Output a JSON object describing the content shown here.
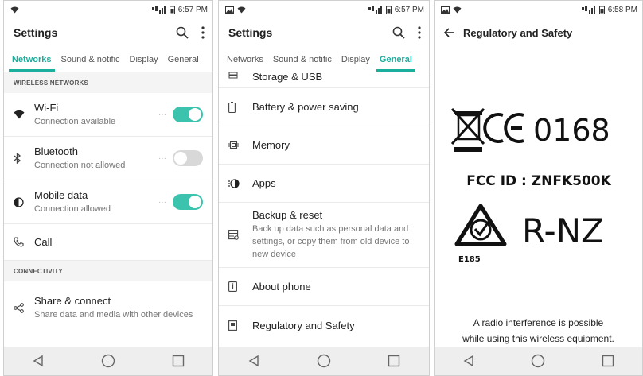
{
  "status": {
    "time1": "6:57 PM",
    "time2": "6:57 PM",
    "time3": "6:58 PM"
  },
  "screen1": {
    "title": "Settings",
    "tabs": [
      "Networks",
      "Sound & notific",
      "Display",
      "General"
    ],
    "section_wireless": "WIRELESS NETWORKS",
    "items": [
      {
        "title": "Wi-Fi",
        "subtitle": "Connection available",
        "toggle": "on"
      },
      {
        "title": "Bluetooth",
        "subtitle": "Connection not allowed",
        "toggle": "off"
      },
      {
        "title": "Mobile data",
        "subtitle": "Connection allowed",
        "toggle": "on"
      },
      {
        "title": "Call",
        "subtitle": ""
      }
    ],
    "section_connectivity": "CONNECTIVITY",
    "share": {
      "title": "Share & connect",
      "subtitle": "Share data and media with other devices"
    }
  },
  "screen2": {
    "title": "Settings",
    "tabs": [
      "Networks",
      "Sound & notific",
      "Display",
      "General"
    ],
    "items": [
      {
        "title": "Storage & USB"
      },
      {
        "title": "Battery & power saving"
      },
      {
        "title": "Memory"
      },
      {
        "title": "Apps"
      },
      {
        "title": "Backup & reset",
        "subtitle": "Back up data such as personal data and settings, or copy them from old device to new device"
      },
      {
        "title": "About phone"
      },
      {
        "title": "Regulatory and Safety"
      }
    ]
  },
  "screen3": {
    "title": "Regulatory and Safety",
    "ce_number": "0168",
    "fcc": "FCC ID : ZNFK500K",
    "rcm": "R-NZ",
    "rcm_code": "E185",
    "notice_line1": "A radio interference is possible",
    "notice_line2": "while using this wireless equipment."
  },
  "colors": {
    "accent": "#1aae9c",
    "toggle_on": "#3cc3ad",
    "toggle_off": "#d8d8d8",
    "navbar": "#eeeeee"
  }
}
